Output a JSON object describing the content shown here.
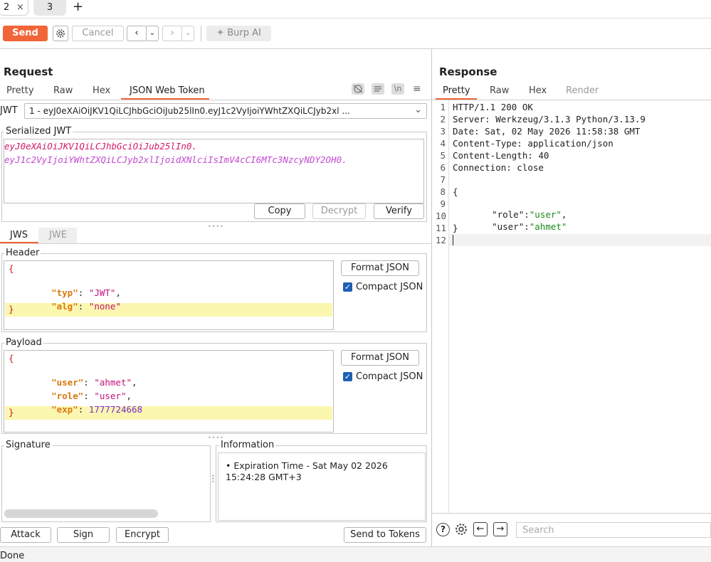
{
  "tabs": [
    {
      "label": "2",
      "close": "×"
    },
    {
      "label": "3"
    }
  ],
  "new_tab_label": "+",
  "toolbar": {
    "send_label": "Send",
    "cancel_label": "Cancel",
    "burp_ai_label": "Burp AI"
  },
  "request": {
    "title": "Request",
    "tabs": [
      "Pretty",
      "Raw",
      "Hex",
      "JSON Web Token"
    ],
    "jwt_label": "JWT",
    "jwt_selected": "1 - eyJ0eXAiOiJKV1QiLCJhbGciOiJub25lIn0.eyJ1c2VyIjoiYWhtZXQiLCJyb2xl ...",
    "serialized_title": "Serialized JWT",
    "serialized_line1": "eyJ0eXAiOiJKV1QiLCJhbGciOiJub25lIn0.",
    "serialized_line2": "eyJ1c2VyIjoiYWhtZXQiLCJyb2xlIjoidXNlciIsImV4cCI6MTc3NzcyNDY2OH0.",
    "copy_label": "Copy",
    "decrypt_label": "Decrypt",
    "verify_label": "Verify",
    "jws_tab": "JWS",
    "jwe_tab": "JWE",
    "header_title": "Header",
    "header": {
      "open": "{",
      "typ_key": "\"typ\"",
      "typ_val": "\"JWT\"",
      "alg_key": "\"alg\"",
      "alg_val": "\"none\"",
      "close": "}"
    },
    "payload_title": "Payload",
    "payload": {
      "open": "{",
      "user_key": "\"user\"",
      "user_val": "\"ahmet\"",
      "role_key": "\"role\"",
      "role_val": "\"user\"",
      "exp_key": "\"exp\"",
      "exp_val": "1777724668",
      "close": "}"
    },
    "format_json_label": "Format JSON",
    "compact_json_label": "Compact JSON",
    "signature_title": "Signature",
    "information_title": "Information",
    "information_text": "• Expiration Time - Sat May 02 2026 15:24:28 GMT+3",
    "attack_label": "Attack",
    "sign_label": "Sign",
    "encrypt_label": "Encrypt",
    "send_to_tokens_label": "Send to Tokens"
  },
  "response": {
    "title": "Response",
    "tabs": [
      "Pretty",
      "Raw",
      "Hex",
      "Render"
    ],
    "lines": [
      "HTTP/1.1 200 OK",
      "Server: Werkzeug/3.1.3 Python/3.13.9",
      "Date: Sat, 02 May 2026 11:58:38 GMT",
      "Content-Type: application/json",
      "Content-Length: 40",
      "Connection: close",
      "",
      "{",
      "",
      "",
      "}",
      ""
    ],
    "json_role_key": "\"role\"",
    "json_role_val": "\"user\"",
    "json_user_key": "\"user\"",
    "json_user_val": "\"ahmet\"",
    "search_placeholder": "Search"
  },
  "status": "Done",
  "colors": {
    "accent": "#f26538",
    "key": "#d9780f",
    "string": "#c4127a",
    "number": "#7a2ccf"
  }
}
